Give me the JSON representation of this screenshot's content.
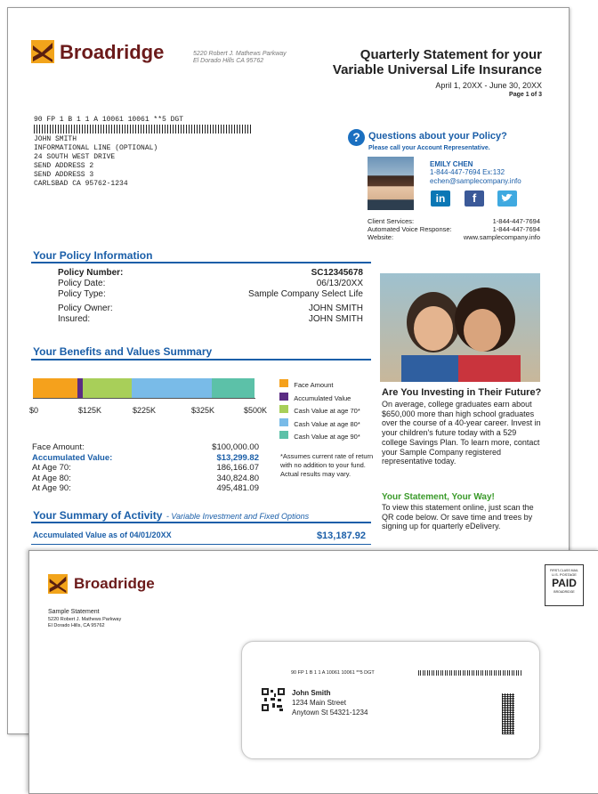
{
  "brand": {
    "name": "Broadridge",
    "addr_line1": "5220 Robert J. Mathews Parkway",
    "addr_line2": "El Dorado Hills CA 95762",
    "logo_icon": "broadridge-tree-icon"
  },
  "header": {
    "title_line1": "Quarterly Statement for your",
    "title_line2": "Variable Universal Life Insurance",
    "period": "April 1, 20XX - June 30, 20XX",
    "page": "Page 1 of 3"
  },
  "mailing": {
    "barcode_line": "90 FP 1 B 1 1 A 10061 10061 **5 DGT",
    "lines": [
      "JOHN SMITH",
      "INFORMATIONAL LINE (OPTIONAL)",
      "24 SOUTH WEST DRIVE",
      "SEND ADDRESS 2",
      "SEND ADDRESS 3",
      "CARLSBAD CA 95762-1234"
    ]
  },
  "questions": {
    "title": "Questions about your Policy?",
    "subtitle": "Please call your Account Representative.",
    "rep_name": "EMILY CHEN",
    "rep_phone": "1-844-447-7694 Ex:132",
    "rep_email": "echen@samplecompany.info",
    "social": [
      "in",
      "f",
      "twitter"
    ],
    "contacts": [
      {
        "label": "Client Services:",
        "value": "1-844-447-7694"
      },
      {
        "label": "Automated Voice Response:",
        "value": "1-844-447-7694"
      },
      {
        "label": "Website:",
        "value": "www.samplecompany.info"
      }
    ]
  },
  "policy": {
    "heading": "Your Policy Information",
    "rows": [
      {
        "label": "Policy Number:",
        "value": "SC12345678"
      },
      {
        "label": "Policy Date:",
        "value": "06/13/20XX"
      },
      {
        "label": "Policy Type:",
        "value": "Sample Company Select Life"
      },
      {
        "label": "Policy Owner:",
        "value": "JOHN SMITH"
      },
      {
        "label": "Insured:",
        "value": "JOHN SMITH"
      }
    ]
  },
  "benefits": {
    "heading": "Your Benefits and Values Summary",
    "axis_ticks": [
      "$0",
      "$125K",
      "$225K",
      "$325K",
      "$500K"
    ],
    "legend": [
      "Face Amount",
      "Accumulated Value",
      "Cash Value at age 70*",
      "Cash Value at age 80*",
      "Cash Value at age 90*"
    ],
    "colors": [
      "#f5a11c",
      "#5b2c83",
      "#a8cf59",
      "#79bbe8",
      "#5cc1a8"
    ],
    "rows": [
      {
        "label": "Face Amount:",
        "value": "$100,000.00"
      },
      {
        "label": "Accumulated Value:",
        "value": "$13,299.82"
      },
      {
        "label": "At Age 70:",
        "value": "186,166.07"
      },
      {
        "label": "At Age 80:",
        "value": "340,824.80"
      },
      {
        "label": "At Age 90:",
        "value": "495,481.09"
      }
    ],
    "note": "*Assumes current rate of return with no addition to your fund. Actual results may vary."
  },
  "activity": {
    "heading": "Your Summary of Activity",
    "heading_sub": "- Variable Investment and Fixed Options",
    "row_label": "Accumulated Value as of 04/01/20XX",
    "row_value": "$13,187.92"
  },
  "promo": {
    "title": "Are You Investing in Their Future?",
    "body": "On average, college graduates earn about $650,000 more than high school graduates over the course of a 40-year career. Invest in your children's future today with a 529 college Savings Plan. To learn more, contact your Sample Company registered representative today.",
    "title2": "Your Statement, Your Way!",
    "body2": "To view this statement online, just scan the QR code below. Or save time and trees by signing up for quarterly eDelivery."
  },
  "envelope": {
    "sender_name": "Sample Statement",
    "sender_line1": "5220 Robert J. Mathews Parkway",
    "sender_line2": "El Dorado Hills, CA 95762",
    "postage_line1": "FIRST-CLASS MAIL",
    "postage_line2": "U.S. POSTAGE",
    "postage_paid": "PAID",
    "postage_line3": "BROADRIDGE",
    "barcode_line": "90 FP 1 B 1 1 A 10061 10061 **5 DGT",
    "recipient_name": "John Smith",
    "recipient_line1": "1234 Main Street",
    "recipient_line2": "Anytown St 54321-1234"
  }
}
